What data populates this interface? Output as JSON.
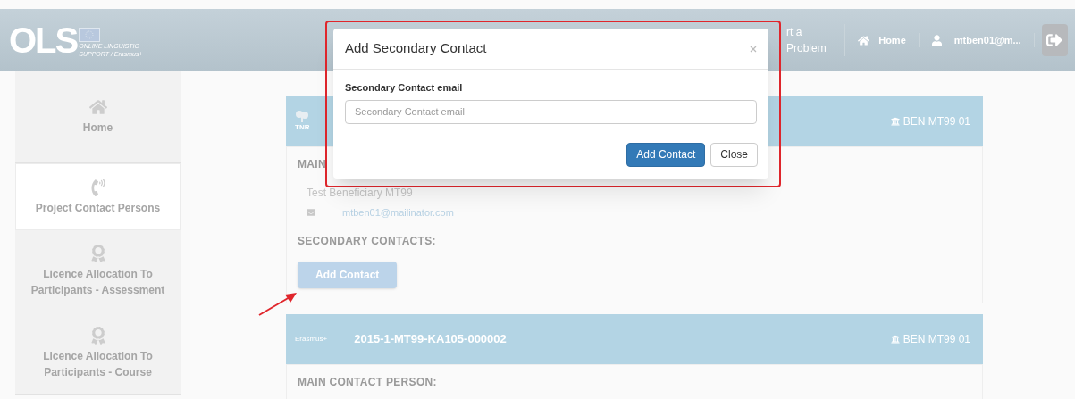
{
  "header": {
    "logo": {
      "letters": "OLS",
      "line_1": "ONLINE LINGUISTIC",
      "line_2": "SUPPORT / Erasmus+"
    },
    "report_link": "rt a Problem",
    "home_link": "Home",
    "user": "mtben01@m..."
  },
  "sidebar": {
    "items": [
      {
        "label": "Home",
        "selected": false
      },
      {
        "label": "Project Contact Persons",
        "selected": true
      },
      {
        "label": "Licence Allocation To Participants - Assessment",
        "selected": false
      },
      {
        "label": "Licence Allocation To Participants - Course",
        "selected": false
      }
    ]
  },
  "projects": [
    {
      "logo_text": "TNR",
      "beneficiary": "BEN MT99 01",
      "main_contact_label": "MAIN",
      "contact_name": "Test Beneficiary MT99",
      "contact_email": "mtben01@mailinator.com",
      "secondary_label": "SECONDARY CONTACTS:",
      "add_button": "Add Contact"
    },
    {
      "logo_text": "Erasmus+",
      "title": "2015-1-MT99-KA105-000002",
      "beneficiary": "BEN MT99 01",
      "main_contact_label": "MAIN CONTACT PERSON:"
    }
  ],
  "modal": {
    "title": "Add Secondary Contact",
    "field_label": "Secondary Contact email",
    "placeholder": "Secondary Contact email",
    "buttons": [
      "Add Contact",
      "Close"
    ]
  }
}
